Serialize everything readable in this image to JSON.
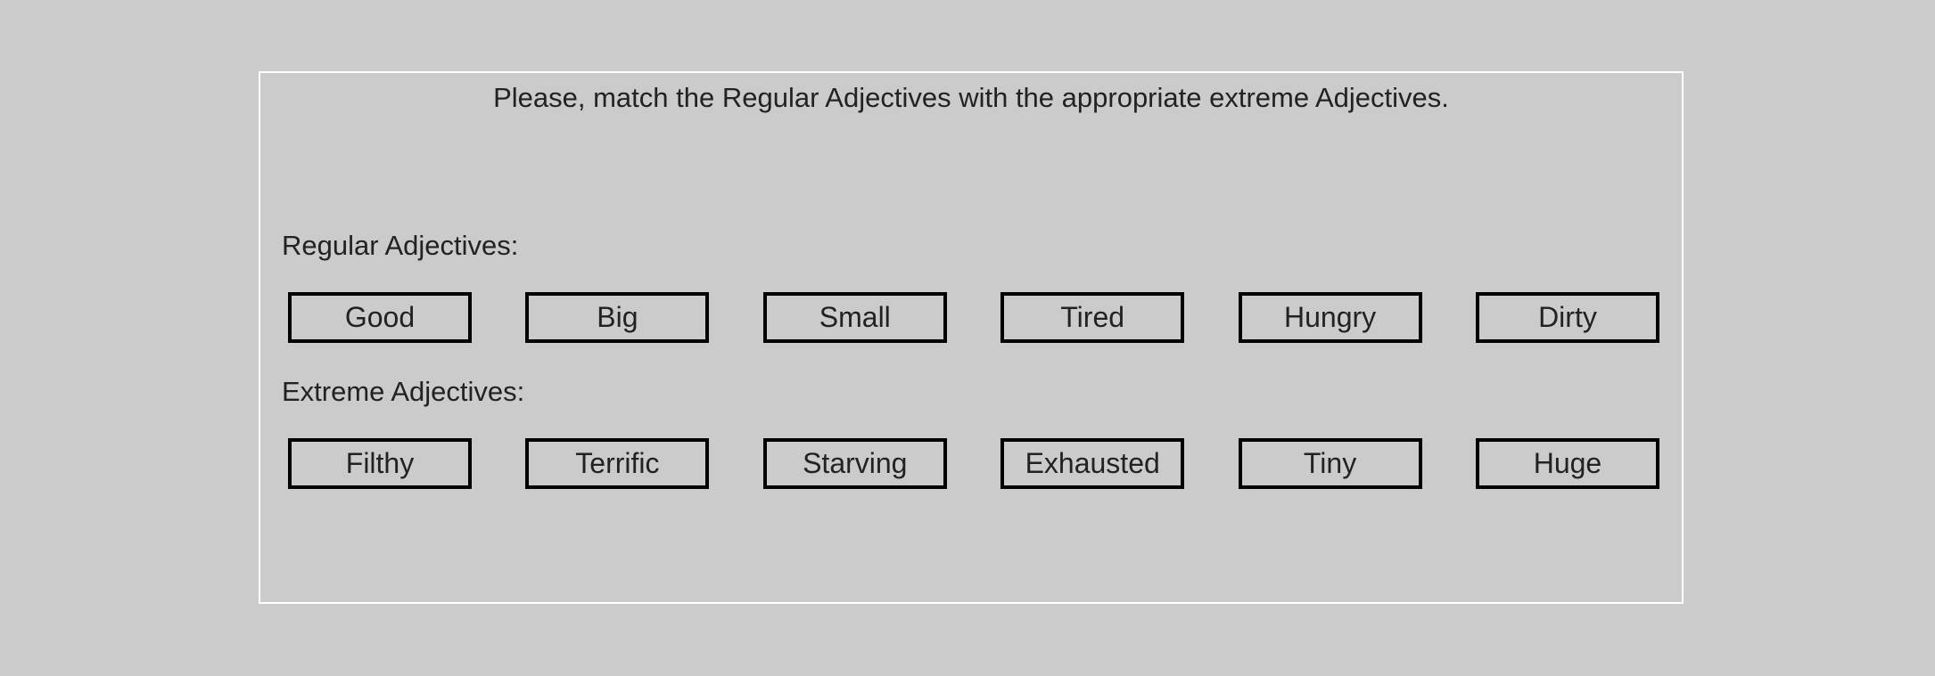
{
  "exercise": {
    "instruction": "Please, match the Regular Adjectives with the appropriate extreme Adjectives.",
    "regular_label": "Regular Adjectives:",
    "extreme_label": "Extreme Adjectives:",
    "regular_words": [
      "Good",
      "Big",
      "Small",
      "Tired",
      "Hungry",
      "Dirty"
    ],
    "extreme_words": [
      "Filthy",
      "Terrific",
      "Starving",
      "Exhausted",
      "Tiny",
      "Huge"
    ]
  },
  "colors": {
    "background": "#cbcbcb",
    "panel_border": "#ffffff",
    "box_border": "#000000",
    "text": "#222222"
  }
}
